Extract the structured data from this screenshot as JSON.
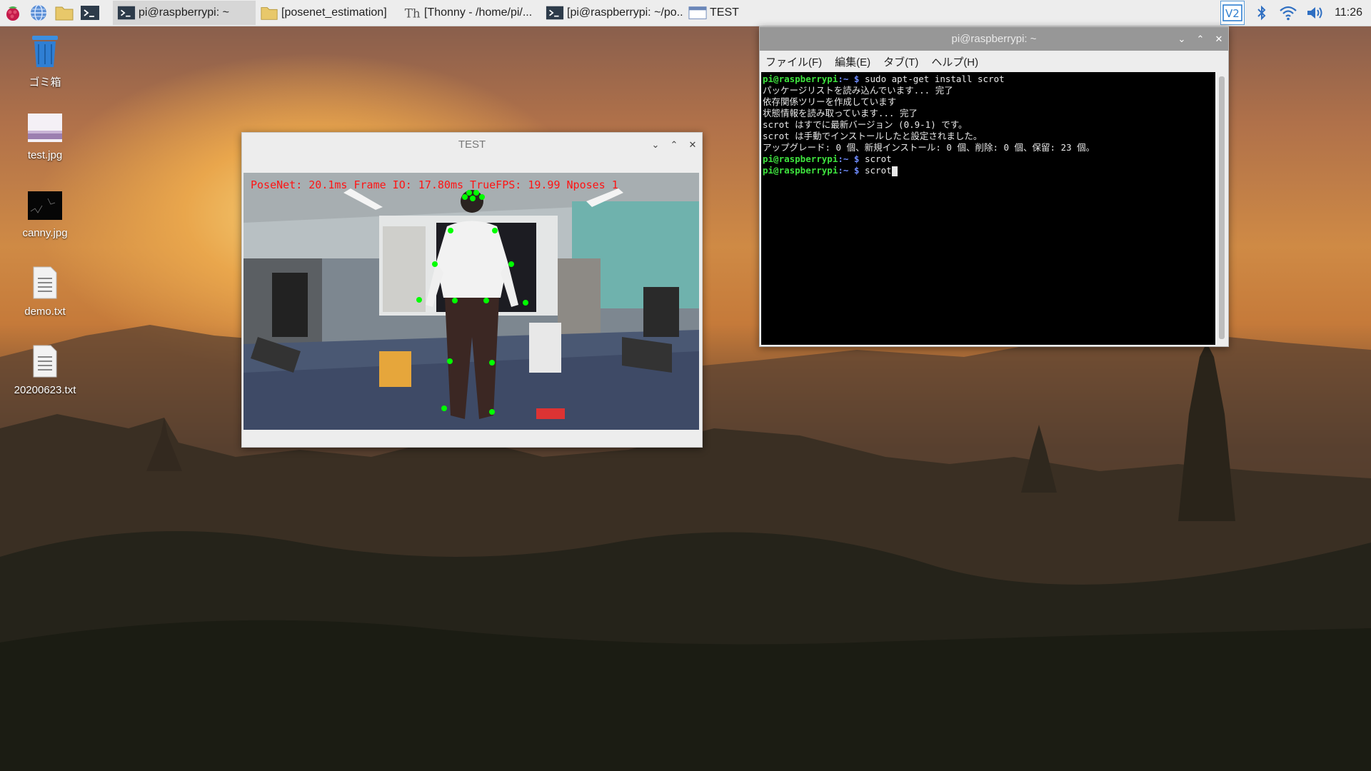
{
  "taskbar": {
    "tasks": [
      {
        "label": "pi@raspberrypi: ~",
        "icon": "terminal-icon"
      },
      {
        "label": "[posenet_estimation]",
        "icon": "folder-icon"
      },
      {
        "label": "[Thonny  -  /home/pi/...",
        "icon": "thonny-icon"
      },
      {
        "label": "[pi@raspberrypi: ~/po...",
        "icon": "terminal-icon"
      },
      {
        "label": "TEST",
        "icon": "window-icon"
      }
    ],
    "clock": "11:26"
  },
  "desktop": {
    "icons": [
      {
        "label": "ゴミ箱",
        "icon": "trash-icon"
      },
      {
        "label": "test.jpg",
        "icon": "image-file-icon"
      },
      {
        "label": "canny.jpg",
        "icon": "image-file-icon"
      },
      {
        "label": "demo.txt",
        "icon": "text-file-icon"
      },
      {
        "label": "20200623.txt",
        "icon": "text-file-icon"
      }
    ]
  },
  "test_window": {
    "title": "TEST",
    "overlay": "PoseNet: 20.1ms Frame IO: 17.80ms TrueFPS: 19.99 Nposes 1"
  },
  "terminal": {
    "title": "pi@raspberrypi: ~",
    "menu": [
      "ファイル(F)",
      "編集(E)",
      "タブ(T)",
      "ヘルプ(H)"
    ],
    "prompt_user": "pi@raspberrypi",
    "prompt_path": ":~ $",
    "lines": [
      {
        "type": "cmd",
        "text": " sudo apt-get install scrot"
      },
      {
        "type": "out",
        "text": "パッケージリストを読み込んでいます... 完了"
      },
      {
        "type": "out",
        "text": "依存関係ツリーを作成しています"
      },
      {
        "type": "out",
        "text": "状態情報を読み取っています... 完了"
      },
      {
        "type": "out",
        "text": "scrot はすでに最新バージョン (0.9-1) です。"
      },
      {
        "type": "out",
        "text": "scrot は手動でインストールしたと設定されました。"
      },
      {
        "type": "out",
        "text": "アップグレード: 0 個、新規インストール: 0 個、削除: 0 個、保留: 23 個。"
      },
      {
        "type": "cmd",
        "text": " scrot"
      },
      {
        "type": "cmd",
        "text": " scrot"
      }
    ]
  },
  "colors": {
    "prompt_green": "#3ee33e",
    "overlay_red": "#ff1414",
    "keypoint_green": "#00ff00"
  }
}
